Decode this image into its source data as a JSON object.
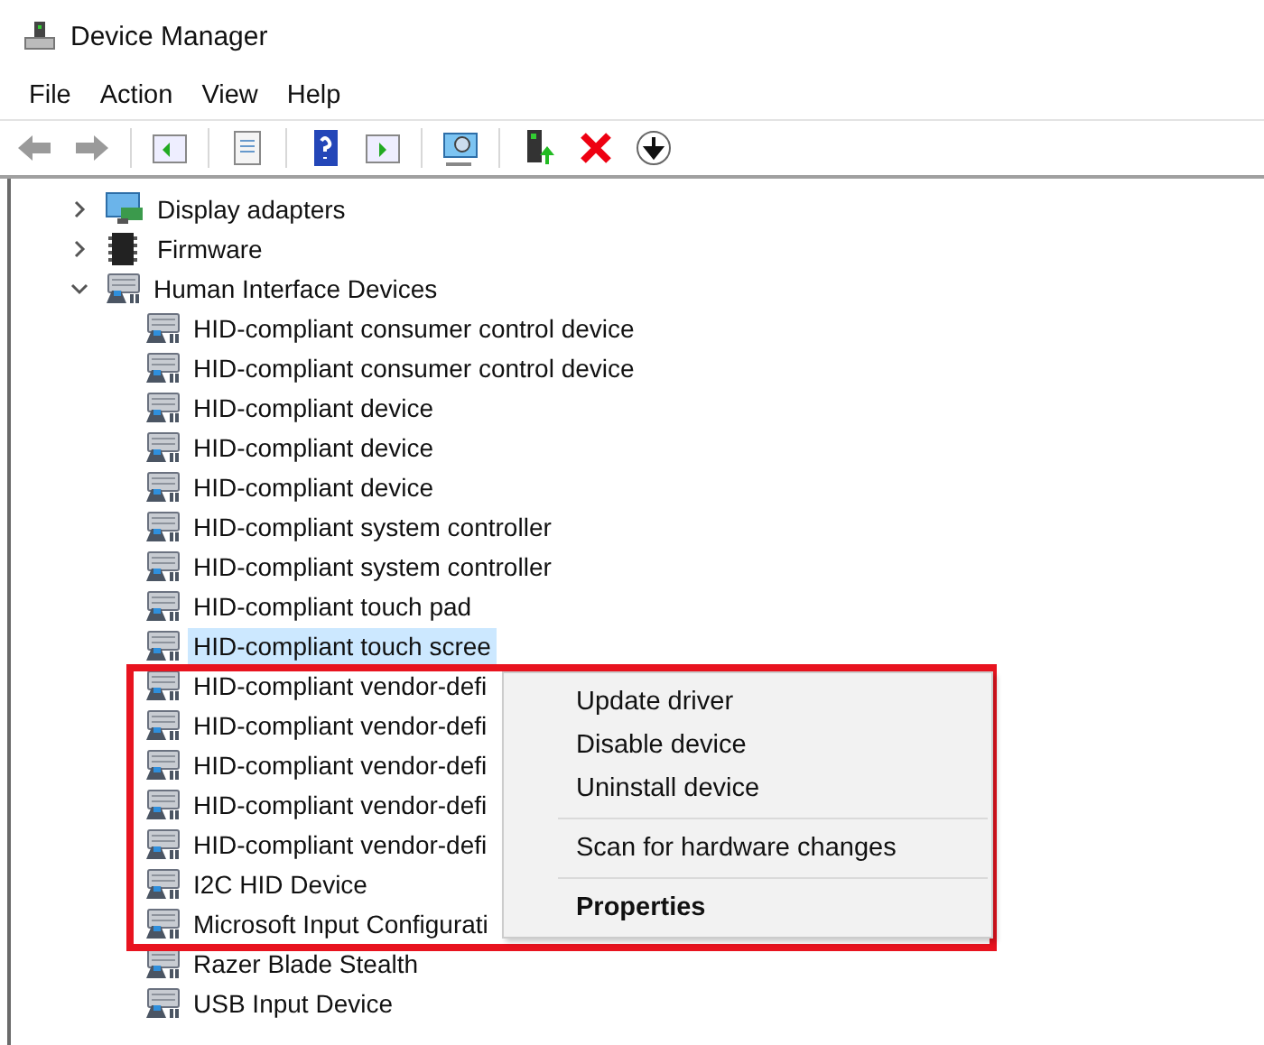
{
  "window": {
    "title": "Device Manager"
  },
  "menu_bar": [
    "File",
    "Action",
    "View",
    "Help"
  ],
  "tree": [
    {
      "label": "Display adapters",
      "kind": "display",
      "expanded": false,
      "selected": false
    },
    {
      "label": "Firmware",
      "kind": "chip",
      "expanded": false,
      "selected": false
    },
    {
      "label": "Human Interface Devices",
      "kind": "hid",
      "expanded": true,
      "selected": false,
      "children": [
        {
          "label": "HID-compliant consumer control device",
          "selected": false
        },
        {
          "label": "HID-compliant consumer control device",
          "selected": false
        },
        {
          "label": "HID-compliant device",
          "selected": false
        },
        {
          "label": "HID-compliant device",
          "selected": false
        },
        {
          "label": "HID-compliant device",
          "selected": false
        },
        {
          "label": "HID-compliant system controller",
          "selected": false
        },
        {
          "label": "HID-compliant system controller",
          "selected": false
        },
        {
          "label": "HID-compliant touch pad",
          "selected": false
        },
        {
          "label": "HID-compliant touch scree",
          "selected": true
        },
        {
          "label": "HID-compliant vendor-defi",
          "selected": false
        },
        {
          "label": "HID-compliant vendor-defi",
          "selected": false
        },
        {
          "label": "HID-compliant vendor-defi",
          "selected": false
        },
        {
          "label": "HID-compliant vendor-defi",
          "selected": false
        },
        {
          "label": "HID-compliant vendor-defi",
          "selected": false
        },
        {
          "label": "I2C HID Device",
          "selected": false
        },
        {
          "label": "Microsoft Input Configurati",
          "selected": false
        },
        {
          "label": "Razer Blade Stealth",
          "selected": false
        },
        {
          "label": "USB Input Device",
          "selected": false
        }
      ]
    }
  ],
  "context_menu": [
    {
      "kind": "item",
      "label": "Update driver",
      "default": false
    },
    {
      "kind": "item",
      "label": "Disable device",
      "default": false
    },
    {
      "kind": "item",
      "label": "Uninstall device",
      "default": false
    },
    {
      "kind": "separator"
    },
    {
      "kind": "item",
      "label": "Scan for hardware changes",
      "default": false
    },
    {
      "kind": "separator"
    },
    {
      "kind": "item",
      "label": "Properties",
      "default": true
    }
  ]
}
